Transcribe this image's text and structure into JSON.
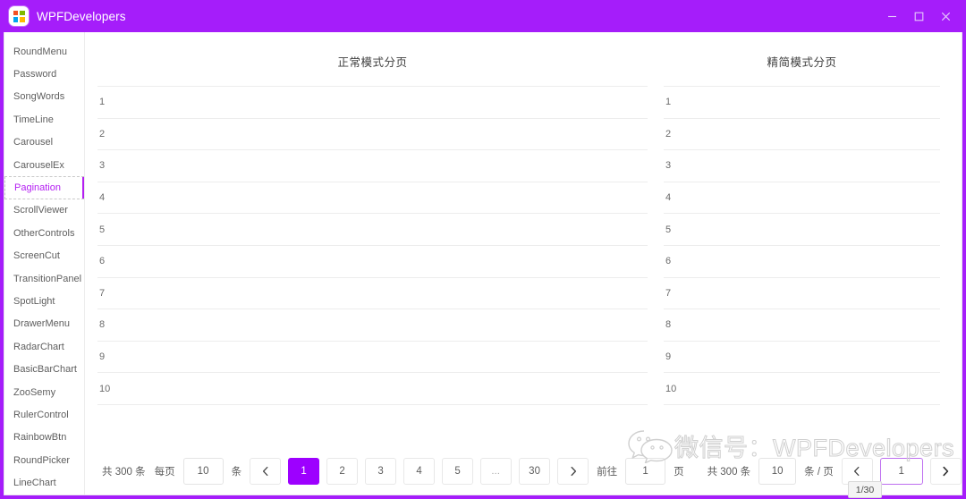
{
  "window": {
    "title": "WPFDevelopers",
    "icon": "app-logo-icon",
    "accent": "#a51dfa",
    "controls": {
      "minimize": "–",
      "maximize": "□",
      "close": "×"
    }
  },
  "sidebar": {
    "items": [
      {
        "label": "RoundMenu",
        "selected": false
      },
      {
        "label": "Password",
        "selected": false
      },
      {
        "label": "SongWords",
        "selected": false
      },
      {
        "label": "TimeLine",
        "selected": false
      },
      {
        "label": "Carousel",
        "selected": false
      },
      {
        "label": "CarouselEx",
        "selected": false
      },
      {
        "label": "Pagination",
        "selected": true
      },
      {
        "label": "ScrollViewer",
        "selected": false
      },
      {
        "label": "OtherControls",
        "selected": false
      },
      {
        "label": "ScreenCut",
        "selected": false
      },
      {
        "label": "TransitionPanel",
        "selected": false
      },
      {
        "label": "SpotLight",
        "selected": false
      },
      {
        "label": "DrawerMenu",
        "selected": false
      },
      {
        "label": "RadarChart",
        "selected": false
      },
      {
        "label": "BasicBarChart",
        "selected": false
      },
      {
        "label": "ZooSemy",
        "selected": false
      },
      {
        "label": "RulerControl",
        "selected": false
      },
      {
        "label": "RainbowBtn",
        "selected": false
      },
      {
        "label": "RoundPicker",
        "selected": false
      },
      {
        "label": "LineChart",
        "selected": false
      }
    ],
    "selected_color": "#b41ff2"
  },
  "panels": {
    "left": {
      "title": "正常模式分页",
      "rows": [
        "1",
        "2",
        "3",
        "4",
        "5",
        "6",
        "7",
        "8",
        "9",
        "10"
      ]
    },
    "right": {
      "title": "精简模式分页",
      "rows": [
        "1",
        "2",
        "3",
        "4",
        "5",
        "6",
        "7",
        "8",
        "9",
        "10"
      ]
    }
  },
  "pagination_normal": {
    "total_label": "共 300 条",
    "per_page_label": "每页",
    "page_size_value": "10",
    "unit_label": "条",
    "prev_icon": "chevron-left-icon",
    "next_icon": "chevron-right-icon",
    "pages": [
      "1",
      "2",
      "3",
      "4",
      "5",
      "…",
      "30"
    ],
    "active_page": "1",
    "goto_label": "前往",
    "goto_value": "1",
    "page_unit_label": "页",
    "active_color": "#9d00ff"
  },
  "pagination_simple": {
    "total_label": "共 300 条",
    "page_size_value": "10",
    "unit_label": "条 / 页",
    "prev_icon": "chevron-left-icon",
    "next_icon": "chevron-right-icon",
    "current_page": "1",
    "focus_color": "#bd6df0"
  },
  "tooltip": {
    "text": "1/30"
  },
  "watermark": {
    "icon": "wechat-icon",
    "text": "微信号：WPFDevelopers"
  }
}
